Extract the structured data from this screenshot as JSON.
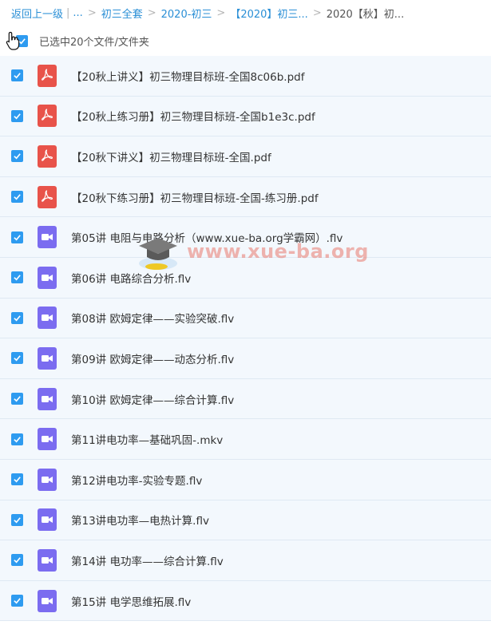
{
  "breadcrumb": {
    "back": "返回上一级",
    "ellipsis": "...",
    "items": [
      "初三全套",
      "2020-初三",
      "【2020】初三...",
      "2020【秋】初..."
    ]
  },
  "selection": {
    "label": "已选中20个文件/文件夹"
  },
  "files": [
    {
      "name": "【20秋上讲义】初三物理目标班-全国8c06b.pdf",
      "type": "pdf"
    },
    {
      "name": "【20秋上练习册】初三物理目标班-全国b1e3c.pdf",
      "type": "pdf"
    },
    {
      "name": "【20秋下讲义】初三物理目标班-全国.pdf",
      "type": "pdf"
    },
    {
      "name": "【20秋下练习册】初三物理目标班-全国-练习册.pdf",
      "type": "pdf"
    },
    {
      "name": "第05讲 电阻与电路分析（www.xue-ba.org学霸网）.flv",
      "type": "video"
    },
    {
      "name": "第06讲 电路综合分析.flv",
      "type": "video"
    },
    {
      "name": "第08讲 欧姆定律——实验突破.flv",
      "type": "video"
    },
    {
      "name": "第09讲 欧姆定律——动态分析.flv",
      "type": "video"
    },
    {
      "name": "第10讲 欧姆定律——综合计算.flv",
      "type": "video"
    },
    {
      "name": "第11讲电功率—基础巩固-.mkv",
      "type": "video"
    },
    {
      "name": "第12讲电功率-实验专题.flv",
      "type": "video"
    },
    {
      "name": "第13讲电功率—电热计算.flv",
      "type": "video"
    },
    {
      "name": "第14讲 电功率——综合计算.flv",
      "type": "video"
    },
    {
      "name": "第15讲 电学思维拓展.flv",
      "type": "video"
    }
  ],
  "watermark": {
    "text": "www.xue-ba.org"
  },
  "colors": {
    "checkbox": "#2e9bf0",
    "pdf": "#e8534a",
    "video": "#7b6cf0",
    "link": "#2a8fd6",
    "row_bg": "#f3f8fd"
  }
}
